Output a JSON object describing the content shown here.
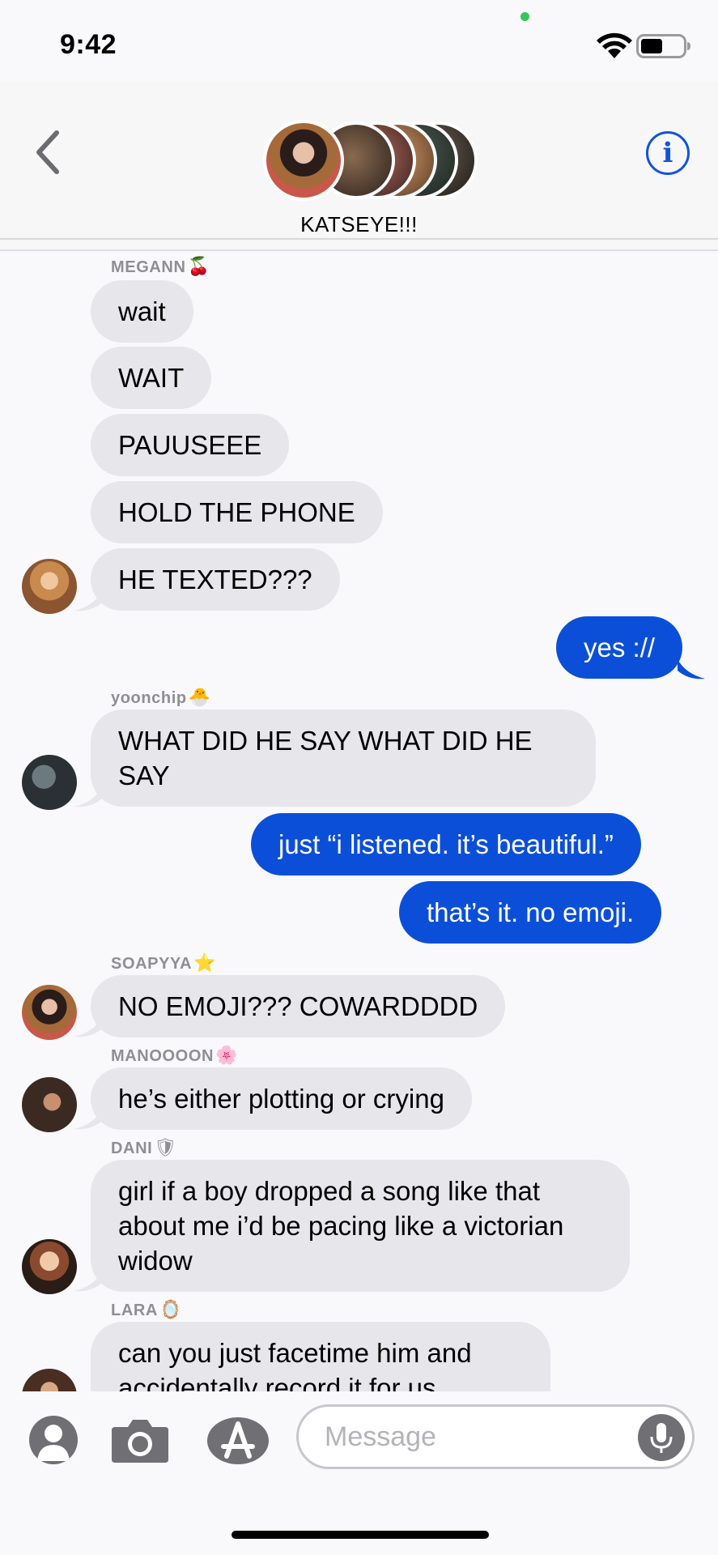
{
  "status_bar": {
    "time": "9:42"
  },
  "header": {
    "group_name": "KATSEYE!!!"
  },
  "input": {
    "placeholder": "Message"
  },
  "messages": [
    {
      "sender": "MEGANN",
      "sender_emoji": "🍒"
    },
    {
      "text": "wait"
    },
    {
      "text": "WAIT"
    },
    {
      "text": "PAUUSEEE"
    },
    {
      "text": "HOLD THE PHONE"
    },
    {
      "text": "HE TEXTED???"
    },
    {
      "text": "yes ://"
    },
    {
      "sender": "yoonchip",
      "sender_emoji": "🐣"
    },
    {
      "text": "WHAT DID HE SAY WHAT DID HE SAY"
    },
    {
      "text": "just “i listened. it’s beautiful.”"
    },
    {
      "text": "that’s it. no emoji."
    },
    {
      "sender": "SOAPYYA",
      "sender_emoji": "⭐"
    },
    {
      "text": "NO EMOJI??? COWARDDDD"
    },
    {
      "sender": "MANOOOON",
      "sender_emoji": "🌸"
    },
    {
      "text": "he’s either plotting or crying"
    },
    {
      "sender": "DANI",
      "sender_emoji": "🛡"
    },
    {
      "text": "girl if a boy dropped a song like that about me i’d be pacing like a victorian widow"
    },
    {
      "sender": "LARA",
      "sender_emoji": "🪞"
    },
    {
      "text": "can you just facetime him and accidentally record it for us"
    }
  ],
  "colors": {
    "outgoing": "#0b4fd9",
    "incoming": "#e7e6eb",
    "accent": "#1153e0"
  },
  "icons": [
    "back-chevron-icon",
    "info-icon",
    "contact-icon",
    "camera-icon",
    "app-store-icon",
    "microphone-icon",
    "wifi-icon",
    "battery-icon"
  ]
}
